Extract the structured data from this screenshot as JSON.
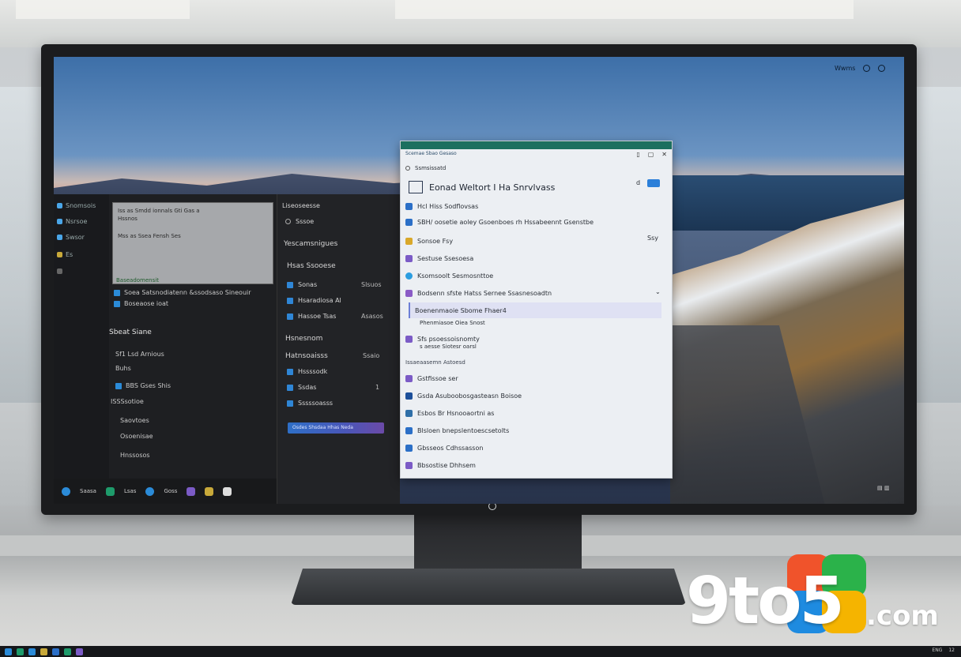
{
  "system": {
    "label": "Wwms"
  },
  "left_nav": {
    "items": [
      {
        "label": "Snomsois",
        "color": "#4aa6e8"
      },
      {
        "label": "Nsrsoe",
        "color": "#4aa6e8"
      },
      {
        "label": "Swsor",
        "color": "#3b8fd4"
      },
      {
        "label": "Es",
        "color": "#c8a93a"
      },
      {
        "label": "",
        "color": "#666666"
      }
    ]
  },
  "preview": {
    "line1": "Iss as Smdd ionnals Gti Gas a",
    "line2": "Hssnos",
    "line3": "Mss as Ssea Fensh Ses",
    "footer": "Baseadomensit"
  },
  "left_list": {
    "items": [
      {
        "label": "Soea Satsnodiatenn &ssodsaso Sineouir",
        "color": "#2b8bd8"
      },
      {
        "label": "Boseaose ioat",
        "color": "#2b8bd8"
      }
    ],
    "section_title": "Sbeat Siane",
    "entries": [
      {
        "label": "Sf1 Lsd Arnious"
      },
      {
        "label": "Buhs"
      },
      {
        "label": "BBS Gses Shis"
      },
      {
        "label": "ISSSsotioe"
      },
      {
        "label": "Saovtoes"
      },
      {
        "label": "Osoenisae"
      },
      {
        "label": "Hnssosos"
      }
    ]
  },
  "mid_column": {
    "header": "Liseoseesse",
    "search": "Sssoe",
    "section1": "Yescamsnigues",
    "section2": "Hsas Ssooese",
    "items1": [
      {
        "label": "Sonas",
        "right": "Slsuos"
      },
      {
        "label": "Hsaradiosa Al",
        "right": ""
      },
      {
        "label": "Hassoe Tsas",
        "right": "Asasos"
      }
    ],
    "section3": "Hsnesnom",
    "section4": "Hatnsoaisss",
    "items2": [
      {
        "label": "Hssssodk",
        "right": ""
      },
      {
        "label": "Ssdas",
        "right": "1"
      },
      {
        "label": "Sssssoasss",
        "right": ""
      }
    ],
    "section4_right": "Ssaio",
    "button_label": "Osdes Shsdaa  Hhas Neda"
  },
  "taskbar": {
    "items": [
      {
        "label": "Saasa",
        "color": "#2b8bd8"
      },
      {
        "label": "Lsas",
        "color": "#1e9b6b"
      },
      {
        "label": "Goss",
        "color": "#2b8bd8"
      },
      {
        "label": "",
        "color": "#7b5bc6"
      },
      {
        "label": "",
        "color": "#c8a93a"
      }
    ]
  },
  "panel": {
    "title": "Scemae Sbao Gesaso",
    "search_label": "Ssmsissatd",
    "heading": "Eonad Weltort I Ha Snrvlvass",
    "rows": [
      {
        "label": "Hcl Hiss Sodflovsas",
        "color": "#2b6fc7",
        "icon": "store-icon"
      },
      {
        "label": "SBH/ oosetie aoley Gsoenboes rh Hssabeennt Gsenstbe",
        "color": "#2b6fc7",
        "icon": "grid-icon"
      },
      {
        "label": "Sonsoe Fsy",
        "color": "#d9a82a",
        "icon": "lock-icon"
      },
      {
        "label": "Sestuse Ssesoesa",
        "color": "#7b5bc6",
        "icon": "box-icon"
      },
      {
        "label": "Ksomsoolt Sesmosnttoe",
        "color": "#2b9de0",
        "icon": "circle-icon"
      },
      {
        "label": "Bodsenn sfste Hatss Sernee Ssasnesoadtn",
        "color": "#8a5bc6",
        "icon": "shield-icon"
      }
    ],
    "selected": "Boenenmaoie Sbome Fhaer4",
    "selected_sub": "Phenmiasoe Oiea Snost",
    "row_next": "Sfs psoessoisnomty",
    "row_next_sub": "s aesse Siotesr oarsl",
    "subheading": "Issaeaasemn Astoesd",
    "rows2": [
      {
        "label": "Gstfissoe ser",
        "color": "#7b5bc6",
        "icon": "doc-icon"
      },
      {
        "label": "Gsda Asuboobosgasteasn Boisoe",
        "color": "#1c4f9a",
        "icon": "vs-icon"
      },
      {
        "label": "Esbos Br Hsnooaortni as",
        "color": "#2f6fa8",
        "icon": "image-icon"
      },
      {
        "label": "Blsloen bnepslentoescsetolts",
        "color": "#2b6fc7",
        "icon": "folder-icon"
      },
      {
        "label": "Gbsseos Cdhssasson",
        "color": "#2b6fc7",
        "icon": "mail-icon"
      },
      {
        "label": "Bbsostise Dhhsem",
        "color": "#7b5bc6",
        "icon": "note-icon"
      }
    ],
    "right_badges": [
      "Ssy",
      "d"
    ]
  },
  "brand": {
    "text": "9to5",
    "suffix": ".com",
    "tile_colors": [
      "#f0532b",
      "#2bb24a",
      "#1e8be0",
      "#f5b400"
    ]
  },
  "host_tray": {
    "text1": "ENG",
    "text2": "12"
  }
}
